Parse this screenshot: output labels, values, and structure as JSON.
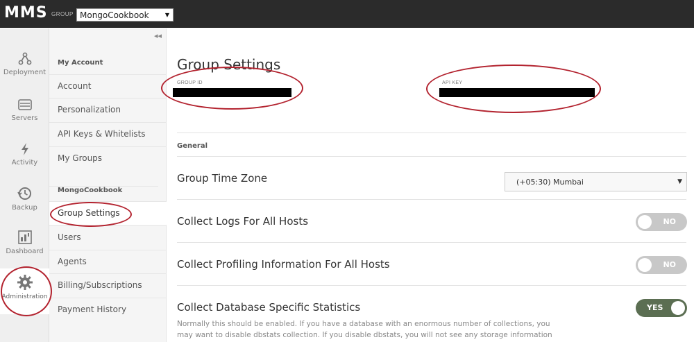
{
  "header": {
    "brand": "MMS",
    "group_label": "GROUP",
    "group_value": "MongoCookbook"
  },
  "iconnav": [
    {
      "label": "Deployment",
      "icon": "deployment-icon"
    },
    {
      "label": "Servers",
      "icon": "servers-icon"
    },
    {
      "label": "Activity",
      "icon": "activity-icon"
    },
    {
      "label": "Backup",
      "icon": "backup-icon"
    },
    {
      "label": "Dashboard",
      "icon": "dashboard-icon"
    },
    {
      "label": "Administration",
      "icon": "gear-icon",
      "active": true
    }
  ],
  "sidebar": {
    "sections": [
      {
        "title": "My Account",
        "items": [
          "Account",
          "Personalization",
          "API Keys & Whitelists",
          "My Groups"
        ]
      },
      {
        "title": "MongoCookbook",
        "items": [
          "Group Settings",
          "Users",
          "Agents",
          "Billing/Subscriptions",
          "Payment History"
        ]
      }
    ],
    "active_item": "Group Settings"
  },
  "main": {
    "title": "Group Settings",
    "group_id_label": "GROUP ID",
    "api_key_label": "API KEY",
    "general_label": "General",
    "rows": [
      {
        "label": "Group Time Zone",
        "control": "select",
        "value": "(+05:30) Mumbai"
      },
      {
        "label": "Collect Logs For All Hosts",
        "control": "toggle",
        "state": "NO"
      },
      {
        "label": "Collect Profiling Information For All Hosts",
        "control": "toggle",
        "state": "NO"
      },
      {
        "label": "Collect Database Specific Statistics",
        "control": "toggle",
        "state": "YES"
      }
    ],
    "description_lines": [
      "Normally this should be enabled. If you have a database with an enormous number of collections, you",
      "may want to disable dbstats collection. If you disable dbstats, you will not see any storage information"
    ]
  },
  "colors": {
    "topbar": "#2b2b2b",
    "toggle_on": "#5b6e52",
    "toggle_off": "#c8c8c8",
    "annotation": "#b3232f"
  }
}
